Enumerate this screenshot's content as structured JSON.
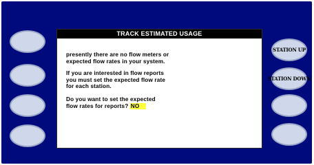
{
  "screen": {
    "title": "TRACK ESTIMATED USAGE",
    "paragraph1": "presently there are no flow meters or\nexpected flow rates in your system.",
    "paragraph2": "If you are interested in flow reports\nyou must set the expected flow rate\nfor each station.",
    "paragraph3": "Do you want to set the expected\nflow rates for reports?",
    "answer": "NO"
  },
  "softkeys": {
    "left": [
      "",
      "",
      "",
      ""
    ],
    "right": [
      "STATION UP",
      "STATION DOWN",
      "",
      ""
    ]
  },
  "colors": {
    "bezel": "#000a7c",
    "softkey": "#cfd7ea",
    "highlight": "#ffff3c"
  }
}
